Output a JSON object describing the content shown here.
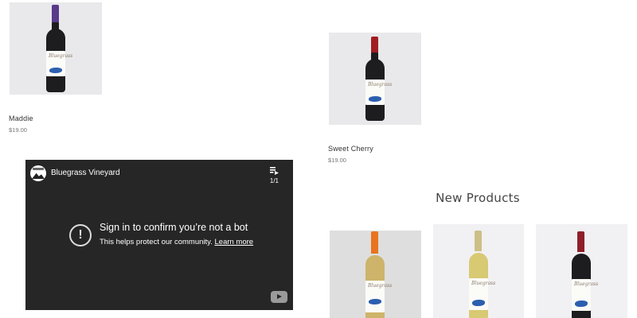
{
  "products": [
    {
      "name": "Maddie",
      "price": "$19.00"
    },
    {
      "name": "Sweet Cherry",
      "price": "$19.00"
    }
  ],
  "video": {
    "channel_name": "Bluegrass Vineyard",
    "playlist_count": "1/1",
    "alert_title": "Sign in to confirm you’re not a bot",
    "alert_text": "This helps protect our community.",
    "alert_link": "Learn more",
    "icons": {
      "playlist": "playlist-icon",
      "alert": "alert-icon",
      "logo": "youtube-logo-icon"
    }
  },
  "new_products": {
    "title": "New Products"
  },
  "label_script": "Bluegrass"
}
